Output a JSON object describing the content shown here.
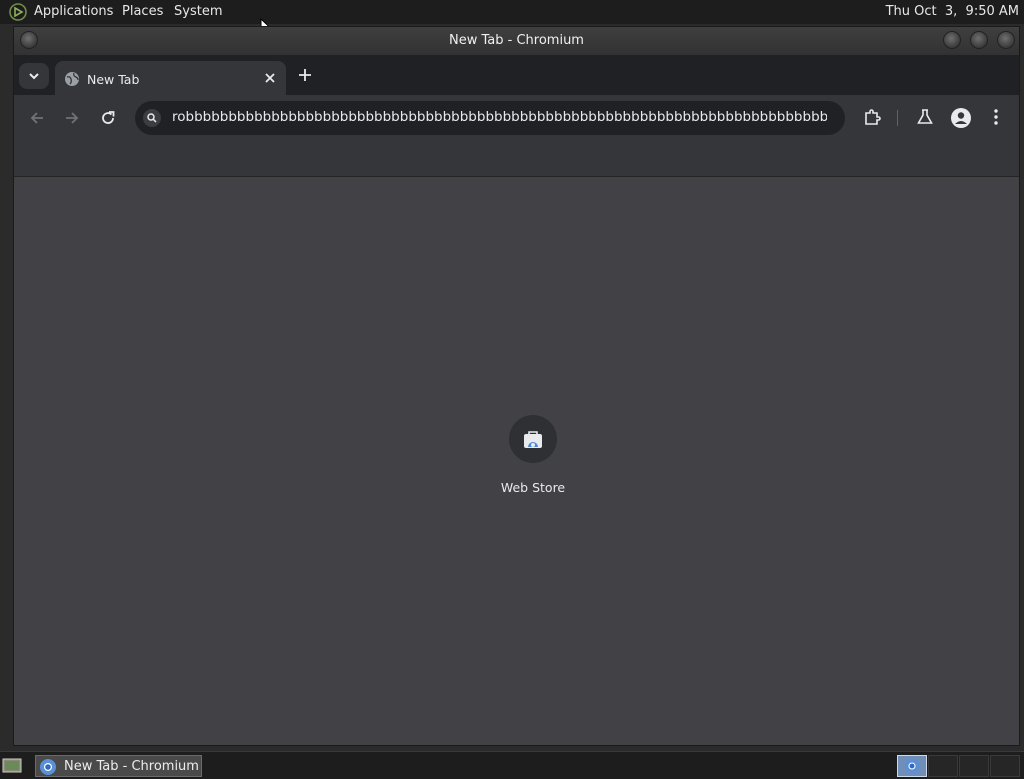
{
  "top_panel": {
    "menus": [
      "Applications",
      "Places",
      "System"
    ],
    "clock": "Thu Oct  3,  9:50 AM"
  },
  "window": {
    "title": "New Tab - Chromium"
  },
  "browser": {
    "tabs": [
      {
        "label": "New Tab"
      }
    ],
    "address": "robbbbbbbbbbbbbbbbbbbbbbbbbbbbbbbbbbbbbbbbbbbbbbbbbbbbbbbbbbbbbbbbbbbbbbbbbbbbbbbbbbb..."
  },
  "new_tab_page": {
    "shortcuts": [
      {
        "label": "Web Store"
      }
    ]
  },
  "taskbar": {
    "tasks": [
      {
        "label": "New Tab - Chromium"
      }
    ]
  },
  "icons": {
    "distro": "distro-logo-icon",
    "tab_search": "chevron-down-icon",
    "tab_favicon": "globe-icon",
    "tab_close": "close-icon",
    "new_tab": "plus-icon",
    "back": "arrow-left-icon",
    "forward": "arrow-right-icon",
    "reload": "reload-icon",
    "omni_search": "search-icon",
    "extensions": "puzzle-icon",
    "labs": "flask-icon",
    "profile": "avatar-icon",
    "menu": "kebab-menu-icon",
    "web_store": "web-store-icon",
    "chromium": "chromium-icon"
  },
  "colors": {
    "content_bg": "#414146",
    "toolbar_bg": "#35363a",
    "tabstrip_bg": "#202124"
  }
}
